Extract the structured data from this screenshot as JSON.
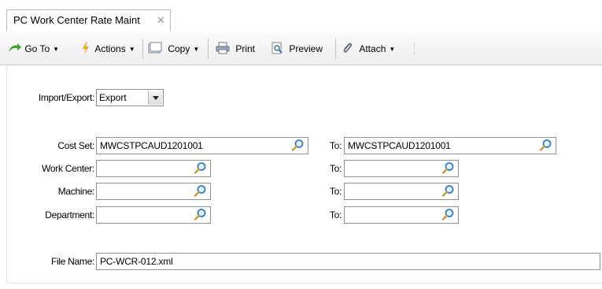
{
  "tab": {
    "title": "PC Work Center Rate Maint",
    "close": "✕"
  },
  "toolbar": {
    "goto": "Go To",
    "actions": "Actions",
    "copy": "Copy",
    "print": "Print",
    "preview": "Preview",
    "attach": "Attach"
  },
  "form": {
    "import_export": {
      "label": "Import/Export:",
      "value": "Export"
    },
    "cost_set": {
      "label": "Cost Set:",
      "value": "MWCSTPCAUD1201001",
      "to_label": "To:",
      "to_value": "MWCSTPCAUD1201001"
    },
    "work_center": {
      "label": "Work Center:",
      "value": "",
      "to_label": "To:",
      "to_value": ""
    },
    "machine": {
      "label": "Machine:",
      "value": "",
      "to_label": "To:",
      "to_value": ""
    },
    "department": {
      "label": "Department:",
      "value": "",
      "to_label": "To:",
      "to_value": ""
    },
    "file_name": {
      "label": "File Name:",
      "value": "PC-WCR-012.xml"
    }
  },
  "icons": {
    "goto": "green-arrow-icon",
    "actions": "lightning-icon",
    "copy": "copy-icon",
    "print": "printer-icon",
    "preview": "preview-icon",
    "attach": "paperclip-icon",
    "lookup": "magnifier-icon"
  },
  "colors": {
    "lookup_lens": "#2f7fd0",
    "goto_arrow": "#3b9a2a",
    "actions_bolt": "#f2a51c"
  }
}
